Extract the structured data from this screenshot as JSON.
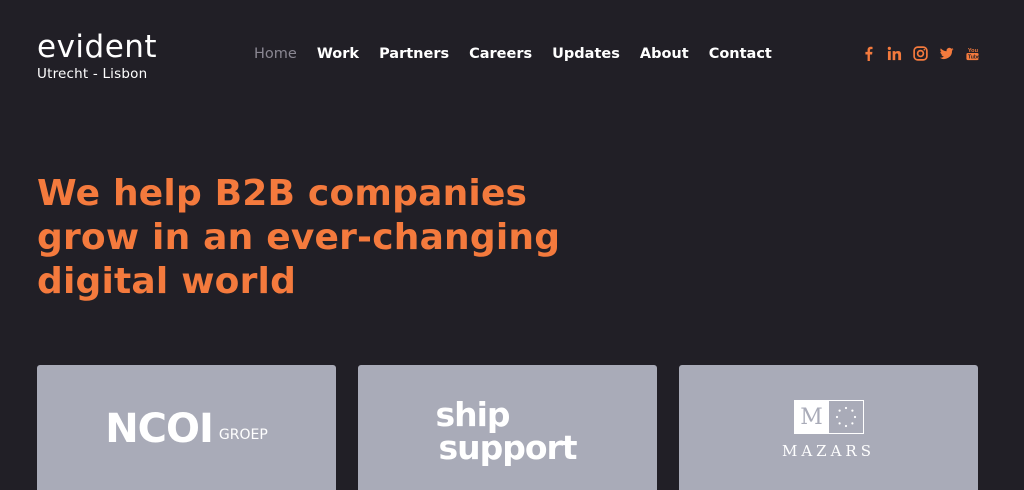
{
  "brand": {
    "name": "evident",
    "location": "Utrecht - Lisbon"
  },
  "nav": {
    "items": [
      {
        "label": "Home",
        "active": true
      },
      {
        "label": "Work"
      },
      {
        "label": "Partners"
      },
      {
        "label": "Careers"
      },
      {
        "label": "Updates"
      },
      {
        "label": "About"
      },
      {
        "label": "Contact"
      }
    ]
  },
  "social": {
    "icons": [
      "facebook-icon",
      "linkedin-icon",
      "instagram-icon",
      "twitter-icon",
      "youtube-icon"
    ],
    "color": "#f47a3d"
  },
  "hero": {
    "line1": "We help B2B companies",
    "line2": "grow in an ever-changing",
    "line3": "digital world"
  },
  "clients": [
    {
      "big": "NCOI",
      "small": "GROEP"
    },
    {
      "line1": "ship",
      "line2": "support"
    },
    {
      "letter": "M",
      "word": "MAZARS"
    }
  ],
  "colors": {
    "background": "#211f26",
    "accent": "#f47a3d",
    "card": "#a9abb8",
    "nav_active": "#8a8792"
  }
}
